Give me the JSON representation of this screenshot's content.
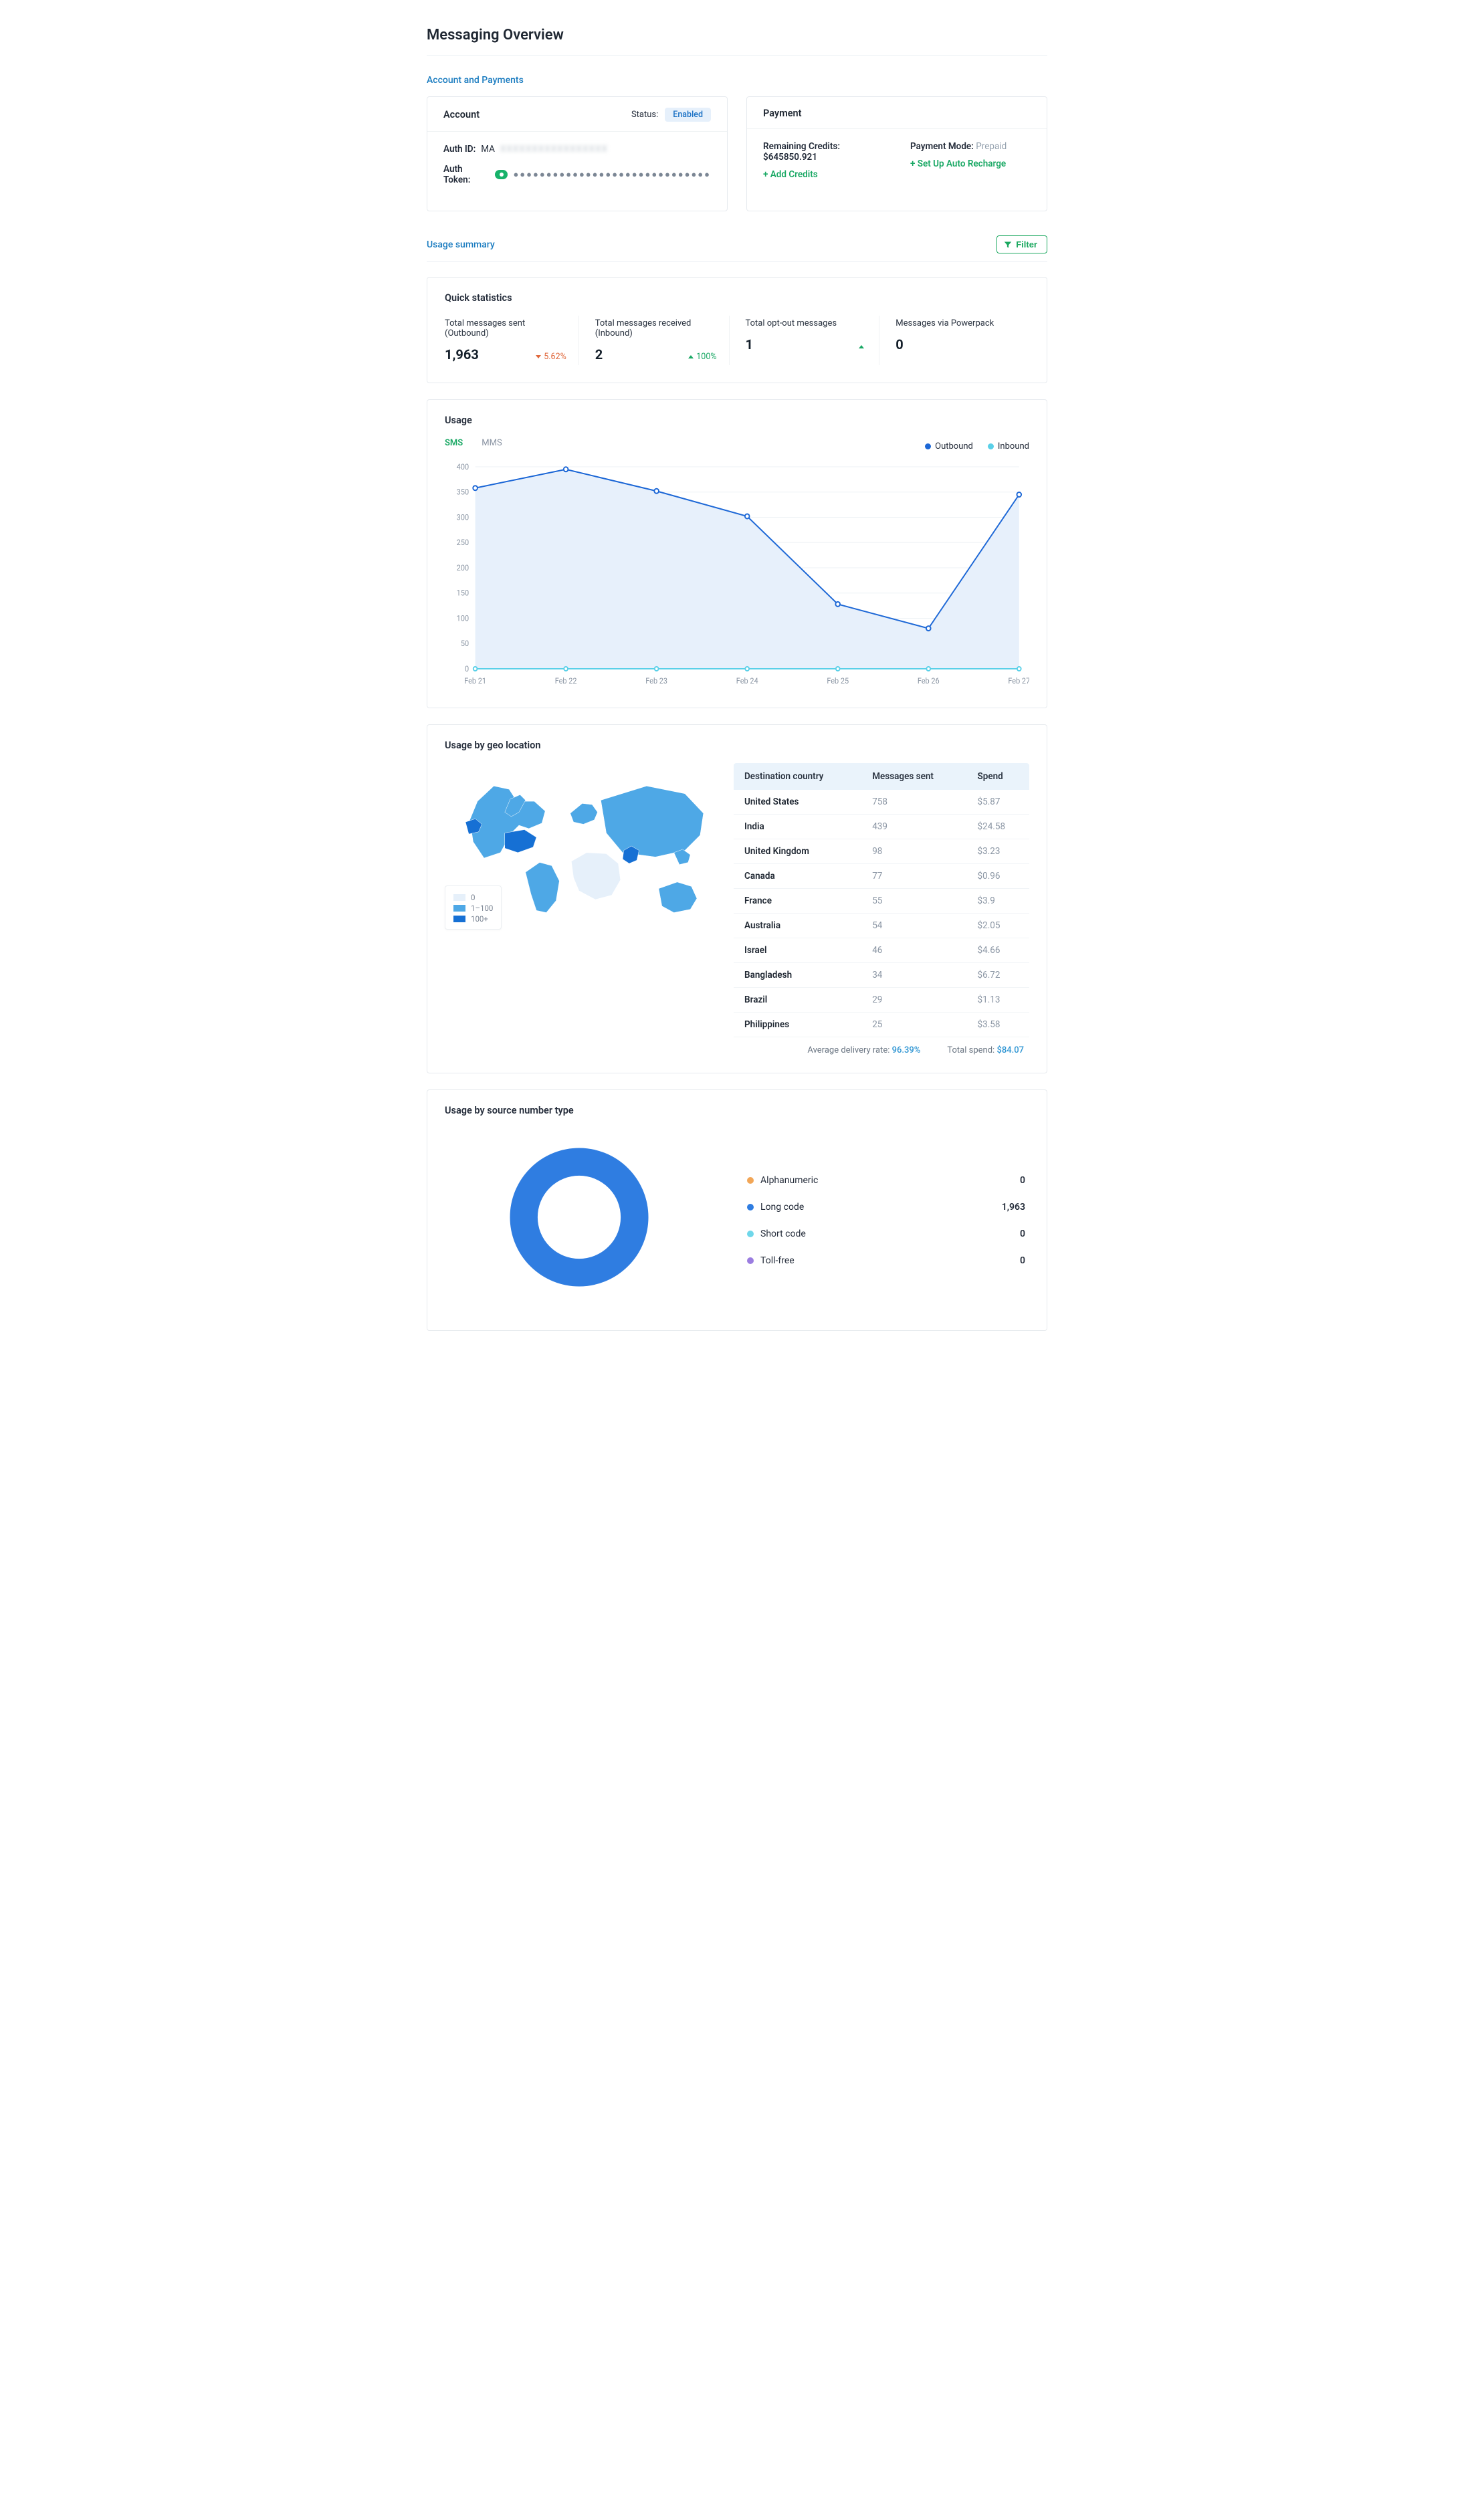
{
  "page_title": "Messaging Overview",
  "sections": {
    "account_payments_label": "Account and Payments",
    "usage_summary_label": "Usage summary"
  },
  "account_card": {
    "title": "Account",
    "status_label": "Status:",
    "status_value": "Enabled",
    "auth_id_label": "Auth ID:",
    "auth_id_prefix": "MA",
    "auth_id_redacted": "XXXXXXXXXXXXXXXXX",
    "auth_token_label": "Auth Token:",
    "auth_token_masked": "●●●●●●●●●●●●●●●●●●●●●●●●●●●●●●"
  },
  "payment_card": {
    "title": "Payment",
    "remaining_label": "Remaining Credits:",
    "remaining_value": "$645850.921",
    "add_credits": "+ Add Credits",
    "mode_label": "Payment Mode:",
    "mode_value": "Prepaid",
    "auto_recharge": "+ Set Up Auto Recharge"
  },
  "filter_label": "Filter",
  "quick_stats": {
    "title": "Quick statistics",
    "items": [
      {
        "label": "Total messages sent (Outbound)",
        "value": "1,963",
        "delta": "5.62%",
        "dir": "down"
      },
      {
        "label": "Total messages received (Inbound)",
        "value": "2",
        "delta": "100%",
        "dir": "up"
      },
      {
        "label": "Total opt-out messages",
        "value": "1",
        "delta": "",
        "dir": "up"
      },
      {
        "label": "Messages via Powerpack",
        "value": "0",
        "delta": "",
        "dir": "none"
      }
    ]
  },
  "usage_card": {
    "title": "Usage",
    "tabs": [
      "SMS",
      "MMS"
    ],
    "active_tab": 0,
    "legend": [
      {
        "label": "Outbound",
        "color": "#1c67d6"
      },
      {
        "label": "Inbound",
        "color": "#5ad0e8"
      }
    ]
  },
  "chart_data": {
    "type": "line",
    "xlabel": "",
    "ylabel": "",
    "ylim": [
      0,
      400
    ],
    "y_ticks": [
      0,
      50,
      100,
      150,
      200,
      250,
      300,
      350,
      400
    ],
    "categories": [
      "Feb 21",
      "Feb 22",
      "Feb 23",
      "Feb 24",
      "Feb 25",
      "Feb 26",
      "Feb 27"
    ],
    "series": [
      {
        "name": "Outbound",
        "color": "#1c67d6",
        "values": [
          358,
          395,
          352,
          302,
          128,
          80,
          345
        ]
      },
      {
        "name": "Inbound",
        "color": "#5ad0e8",
        "values": [
          0,
          0,
          0,
          0,
          0,
          0,
          0
        ]
      }
    ]
  },
  "geo_card": {
    "title": "Usage by geo location",
    "columns": [
      "Destination country",
      "Messages sent",
      "Spend"
    ],
    "rows": [
      {
        "country": "United States",
        "sent": "758",
        "spend": "$5.87"
      },
      {
        "country": "India",
        "sent": "439",
        "spend": "$24.58"
      },
      {
        "country": "United Kingdom",
        "sent": "98",
        "spend": "$3.23"
      },
      {
        "country": "Canada",
        "sent": "77",
        "spend": "$0.96"
      },
      {
        "country": "France",
        "sent": "55",
        "spend": "$3.9"
      },
      {
        "country": "Australia",
        "sent": "54",
        "spend": "$2.05"
      },
      {
        "country": "Israel",
        "sent": "46",
        "spend": "$4.66"
      },
      {
        "country": "Bangladesh",
        "sent": "34",
        "spend": "$6.72"
      },
      {
        "country": "Brazil",
        "sent": "29",
        "spend": "$1.13"
      },
      {
        "country": "Philippines",
        "sent": "25",
        "spend": "$3.58"
      }
    ],
    "footer": {
      "avg_label": "Average delivery rate:",
      "avg_value": "96.39%",
      "total_label": "Total spend:",
      "total_value": "$84.07"
    },
    "map_legend": [
      "0",
      "1–100",
      "100+"
    ],
    "map_colors": [
      "#e6f0fa",
      "#4ea8e6",
      "#1670d4"
    ]
  },
  "donut_card": {
    "title": "Usage by source number type",
    "items": [
      {
        "label": "Alphanumeric",
        "value": "0",
        "color": "#f2a657"
      },
      {
        "label": "Long code",
        "value": "1,963",
        "color": "#2f7de1"
      },
      {
        "label": "Short code",
        "value": "0",
        "color": "#6fd7ea"
      },
      {
        "label": "Toll-free",
        "value": "0",
        "color": "#9b7de0"
      }
    ]
  }
}
